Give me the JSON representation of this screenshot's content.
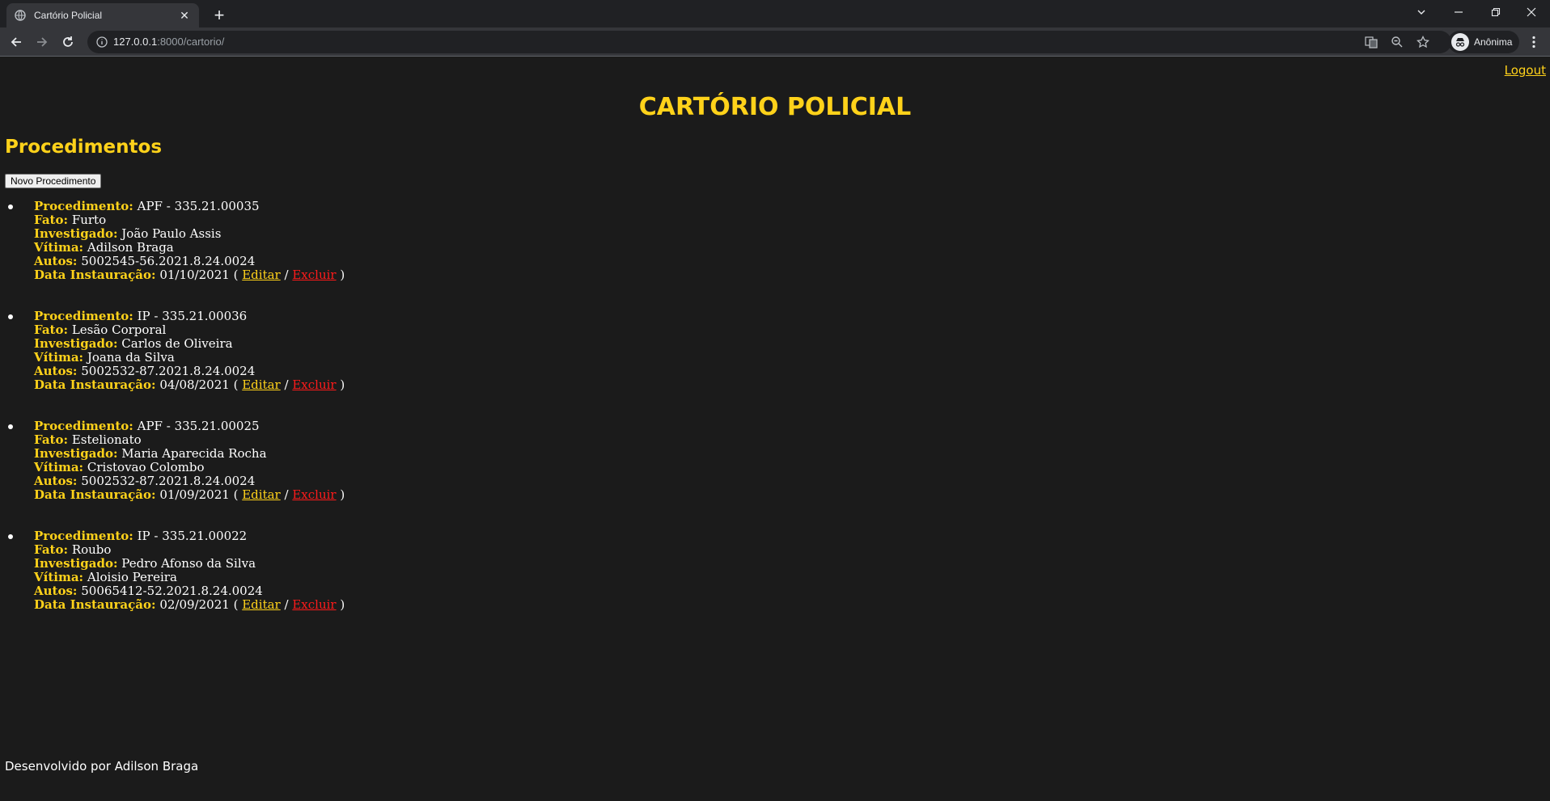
{
  "browser": {
    "tab_title": "Cartório Policial",
    "url_host": "127.0.0.1",
    "url_rest": ":8000/cartorio/",
    "profile_label": "Anônima"
  },
  "page": {
    "logout_label": "Logout",
    "title": "CARTÓRIO POLICIAL",
    "section_title": "Procedimentos",
    "new_button_label": "Novo Procedimento",
    "footer": "Desenvolvido por Adilson Braga"
  },
  "labels": {
    "procedimento": "Procedimento:",
    "fato": "Fato:",
    "investigado": "Investigado:",
    "vitima": "Vítima:",
    "autos": "Autos:",
    "data": "Data Instauração:",
    "edit": "Editar",
    "delete": "Excluir",
    "open_paren": "(",
    "slash": "/",
    "close_paren": ")"
  },
  "records": [
    {
      "procedimento": "APF - 335.21.00035",
      "fato": "Furto",
      "investigado": "João Paulo Assis",
      "vitima": "Adilson Braga",
      "autos": "5002545-56.2021.8.24.0024",
      "data": "01/10/2021"
    },
    {
      "procedimento": "IP - 335.21.00036",
      "fato": "Lesão Corporal",
      "investigado": "Carlos de Oliveira",
      "vitima": "Joana da Silva",
      "autos": "5002532-87.2021.8.24.0024",
      "data": "04/08/2021"
    },
    {
      "procedimento": "APF - 335.21.00025",
      "fato": "Estelionato",
      "investigado": "Maria Aparecida Rocha",
      "vitima": "Cristovao Colombo",
      "autos": "5002532-87.2021.8.24.0024",
      "data": "01/09/2021"
    },
    {
      "procedimento": "IP - 335.21.00022",
      "fato": "Roubo",
      "investigado": "Pedro Afonso da Silva",
      "vitima": "Aloisio Pereira",
      "autos": "50065412-52.2021.8.24.0024",
      "data": "02/09/2021"
    }
  ],
  "colors": {
    "accent": "#ffd21a",
    "delete": "#ff1a1a",
    "background": "#1b1b1b"
  }
}
